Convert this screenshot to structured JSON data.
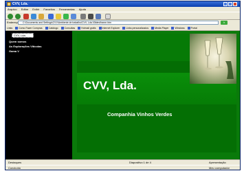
{
  "window": {
    "title": "CVV, Lda.",
    "menu": [
      "Arquivo",
      "Editar",
      "Exibir",
      "Favoritos",
      "Ferramentas",
      "Ajuda"
    ]
  },
  "address_bar": {
    "label": "Endereço",
    "url": "C:\\Documents and Settings\\CVV\\Ambiente de trabalho\\CVV, Lda.\\Slides\\frame.htm",
    "go_label": "Ir"
  },
  "links_bar": {
    "label": "Links",
    "items": [
      "Como Fazer Compras",
      "Catálogo",
      "Consultas",
      "Hotmail grátis",
      "Internet Explorer",
      "Links personalizados",
      "Media Player",
      "Windows",
      "Portal"
    ]
  },
  "outline": {
    "items": [
      "CVV, Lda.",
      "Quem somos",
      "As Explorações Vitícolas",
      "Gama V"
    ]
  },
  "slide": {
    "title": "CVV, Lda.",
    "subtitle": "Companhia Vinhos Verdes"
  },
  "ppt_status": {
    "outline_toggle": "Destaques",
    "slide_counter": "Diapositivo 1 de 4",
    "slideshow": "Apresentação"
  },
  "ie_status": {
    "left": "Concluído",
    "right": "Meu computador"
  }
}
